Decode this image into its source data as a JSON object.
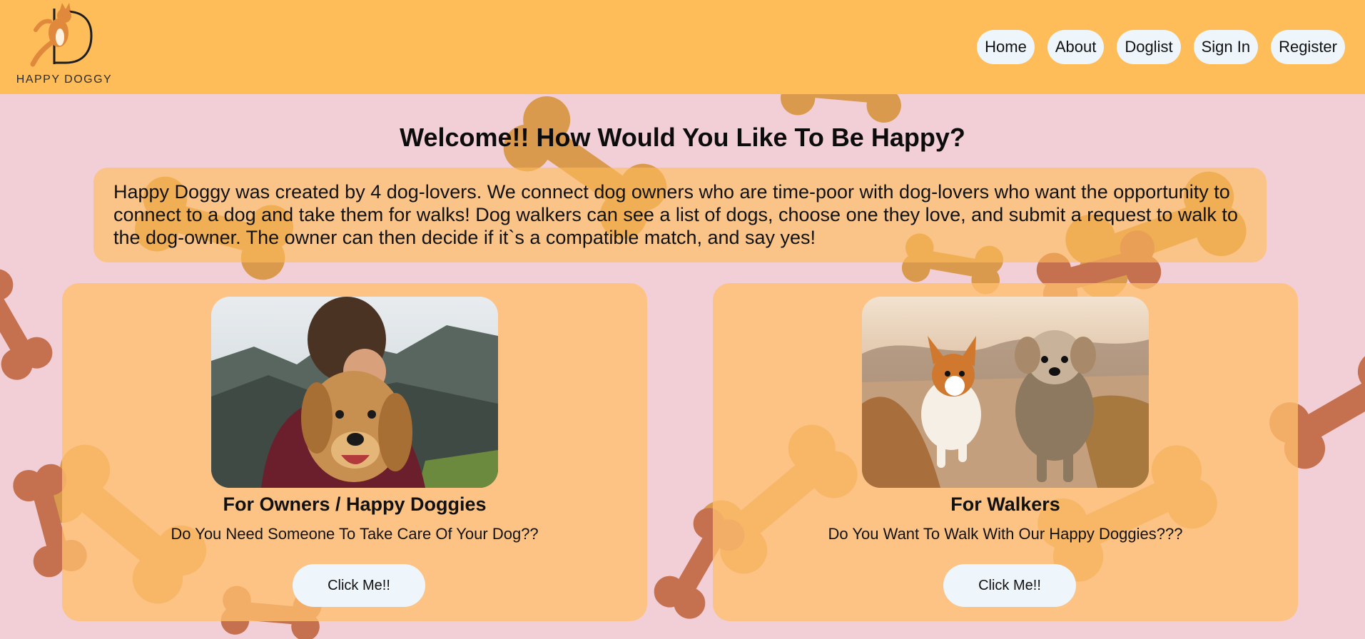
{
  "brand": {
    "name": "HAPPY DOGGY",
    "accent": "#ffbd5a",
    "background": "#f2cfd6"
  },
  "nav": {
    "home": "Home",
    "about": "About",
    "doglist": "Doglist",
    "signin": "Sign In",
    "register": "Register"
  },
  "hero": {
    "title": "Welcome!! How Would You Like To Be Happy?",
    "intro": "Happy Doggy was created by 4 dog-lovers. We connect dog owners who are time-poor with dog-lovers who want the opportunity to connect to a dog and take them for walks! Dog walkers can see a list of dogs, choose one they love, and submit a request to walk to the dog-owner. The owner can then decide if it`s a compatible match, and say yes!"
  },
  "cards": [
    {
      "title": "For Owners / Happy Doggies",
      "subtitle": "Do You Need Someone To Take Care Of Your Dog??",
      "button": "Click Me!!"
    },
    {
      "title": "For Walkers",
      "subtitle": "Do You Want To Walk With Our Happy Doggies???",
      "button": "Click Me!!"
    }
  ]
}
